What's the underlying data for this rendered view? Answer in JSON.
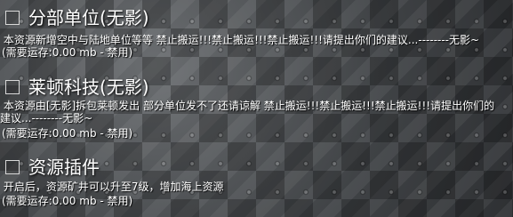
{
  "mods": [
    {
      "title": "分部单位(无影)",
      "description": " 本资源新增空中与陆地单位等等 禁止搬运!!!禁止搬运!!!禁止搬运!!!请提出你们的建议...--------无影~",
      "size_text": "(需要运存:0.00 mb - 禁用)",
      "checked": false
    },
    {
      "title": "莱顿科技(无影)",
      "description": " 本资源由[无影]拆包莱顿发出 部分单位发不了还请谅解 禁止搬运!!!禁止搬运!!!禁止搬运!!!请提出你们的\n建议...--------无影~",
      "size_text": "(需要运存:0.00 mb - 禁用)",
      "checked": false
    },
    {
      "title": "资源插件",
      "description": " 开启后，资源矿井可以升至7级，增加海上资源",
      "size_text": "(需要运存:0.00 mb - 禁用)",
      "checked": false
    }
  ]
}
